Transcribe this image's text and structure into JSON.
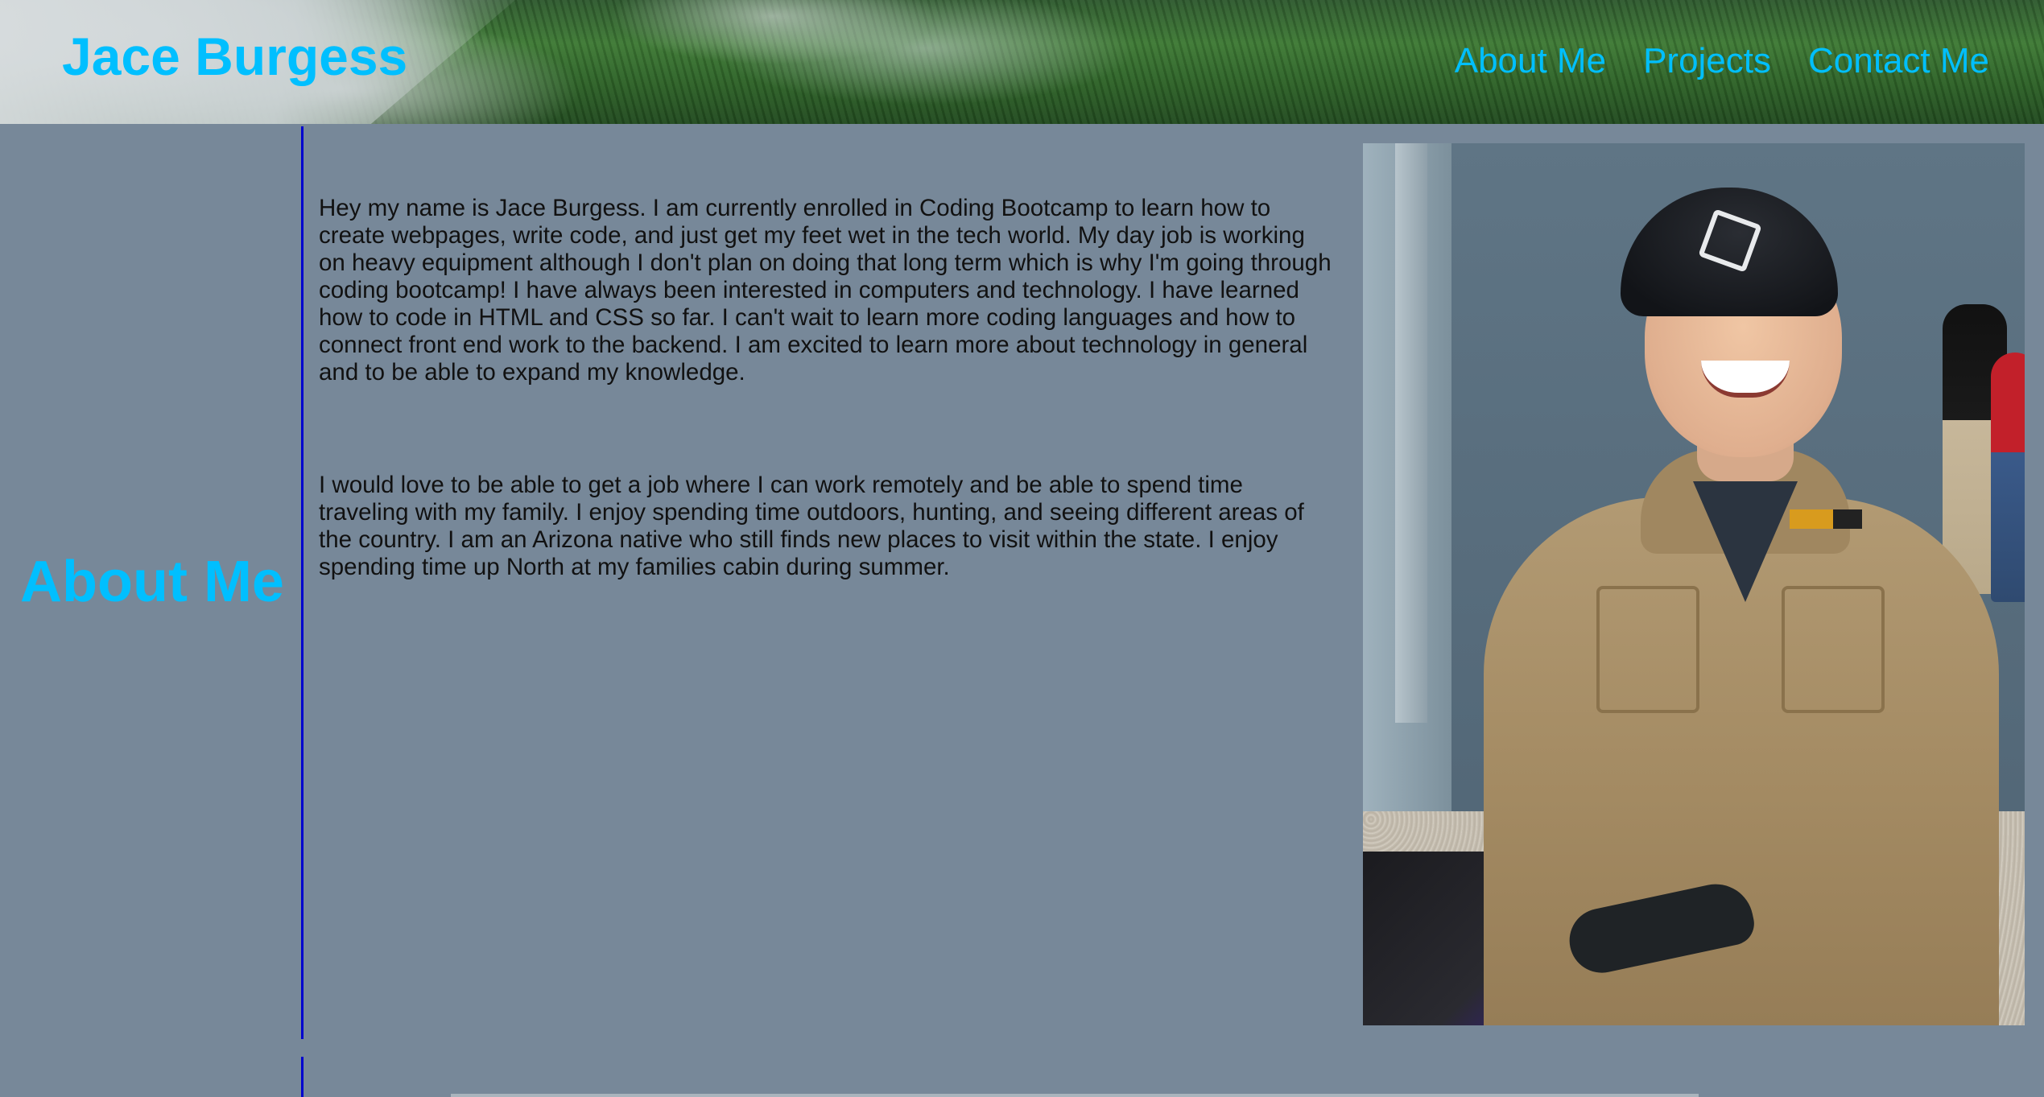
{
  "header": {
    "title": "Jace Burgess",
    "nav": [
      {
        "label": "About Me"
      },
      {
        "label": "Projects"
      },
      {
        "label": "Contact Me"
      }
    ]
  },
  "about": {
    "heading": "About Me",
    "paragraphs": [
      "Hey my name is Jace Burgess. I am currently enrolled in Coding Bootcamp to learn how to create webpages, write code, and just get my feet wet in the tech world. My day job is working on heavy equipment although I don't plan on doing that long term which is why I'm going through coding bootcamp! I have always been interested in computers and technology. I have learned how to code in HTML and CSS so far. I can't wait to learn more coding languages and how to connect front end work to the backend. I am excited to learn more about technology in general and to be able to expand my knowledge.",
      "I would love to be able to get a job where I can work remotely and be able to spend time traveling with my family. I enjoy spending time outdoors, hunting, and seeing different areas of the country. I am an Arizona native who still finds new places to visit within the state. I enjoy spending time up North at my families cabin during summer."
    ]
  },
  "colors": {
    "background": "#778899",
    "accent": "#00bfff",
    "divider": "#0000cd",
    "body_text": "#111111"
  }
}
